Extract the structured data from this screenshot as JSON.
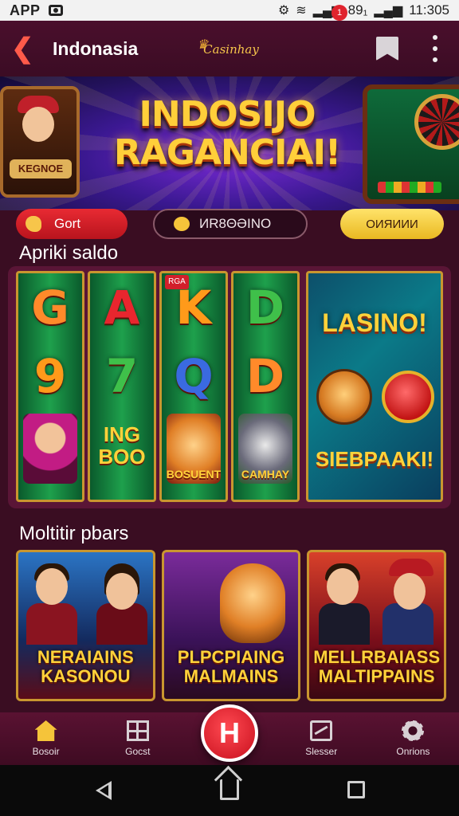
{
  "status_bar": {
    "app_label": "APP",
    "time": "11:305",
    "signal_text": "89₁"
  },
  "appbar": {
    "title": "Indonasia",
    "logo_text": "Casinhay"
  },
  "hero": {
    "title_line1": "INDOSIJO",
    "title_line2": "RAGANCIAI!",
    "dealer_plate": "KEGNOE"
  },
  "chips": {
    "red": "Gort",
    "dark": "ИR8ΘƏINO",
    "gold": "ОИЯИИИ"
  },
  "sections": {
    "slots_title": "Apriki saldo",
    "multiplayer_title": "Moltitir pbars"
  },
  "slots": {
    "reels": [
      {
        "top": "G",
        "mid": "9",
        "art_label": "",
        "bottom_text": "",
        "top_color": "#ff8a2a",
        "mid_color": "#ff9a1a"
      },
      {
        "top": "A",
        "mid": "7",
        "art_label": "",
        "bottom_text": "ING BOO",
        "top_color": "#e8262e",
        "mid_color": "#3fc04a"
      },
      {
        "top": "K",
        "mid": "Q",
        "art_label": "BOSUENT",
        "bottom_text": "",
        "top_color": "#ff9a1a",
        "mid_color": "#3a6ae0"
      },
      {
        "top": "D",
        "mid": "D",
        "art_label": "CAMHAY",
        "bottom_text": "",
        "top_color": "#3fc04a",
        "mid_color": "#ff8a2a"
      }
    ],
    "reel3_badge": "RGA",
    "lasino": {
      "title": "LASINO!",
      "footer": "SIEBPAAKI!"
    }
  },
  "cards": [
    {
      "line1": "NERAIAINS",
      "line2": "KASONOU"
    },
    {
      "line1": "PLPCPIAING",
      "line2": "MALMAINS"
    },
    {
      "line1": "MELLRBAIASS",
      "line2": "MALTIPPAINS"
    }
  ],
  "bottom_nav": [
    {
      "label": "Bosoir",
      "icon": "home-icon"
    },
    {
      "label": "Gocst",
      "icon": "grid-icon"
    },
    {
      "label": "",
      "icon": "h-icon"
    },
    {
      "label": "Slesser",
      "icon": "chart-icon"
    },
    {
      "label": "Onrions",
      "icon": "gear-icon"
    }
  ],
  "notification_count": "1",
  "fab_label": "H"
}
